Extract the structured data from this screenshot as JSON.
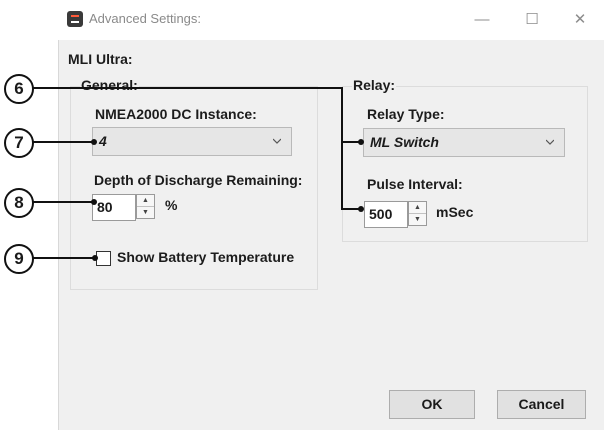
{
  "window": {
    "title": "Advanced Settings:",
    "minimize_glyph": "—",
    "maximize_glyph": "☐",
    "close_glyph": "✕"
  },
  "device_label": "MLI Ultra:",
  "general": {
    "group_label": "General:",
    "nmea_label": "NMEA2000 DC Instance:",
    "nmea_value": "4",
    "dod_label": "Depth of Discharge Remaining:",
    "dod_value": "80",
    "dod_unit": "%",
    "show_temp_label": "Show Battery Temperature",
    "show_temp_checked": false
  },
  "relay": {
    "group_label": "Relay:",
    "type_label": "Relay Type:",
    "type_value": "ML Switch",
    "pulse_label": "Pulse Interval:",
    "pulse_value": "500",
    "pulse_unit": "mSec"
  },
  "buttons": {
    "ok": "OK",
    "cancel": "Cancel"
  },
  "callouts": [
    "6",
    "7",
    "8",
    "9"
  ]
}
